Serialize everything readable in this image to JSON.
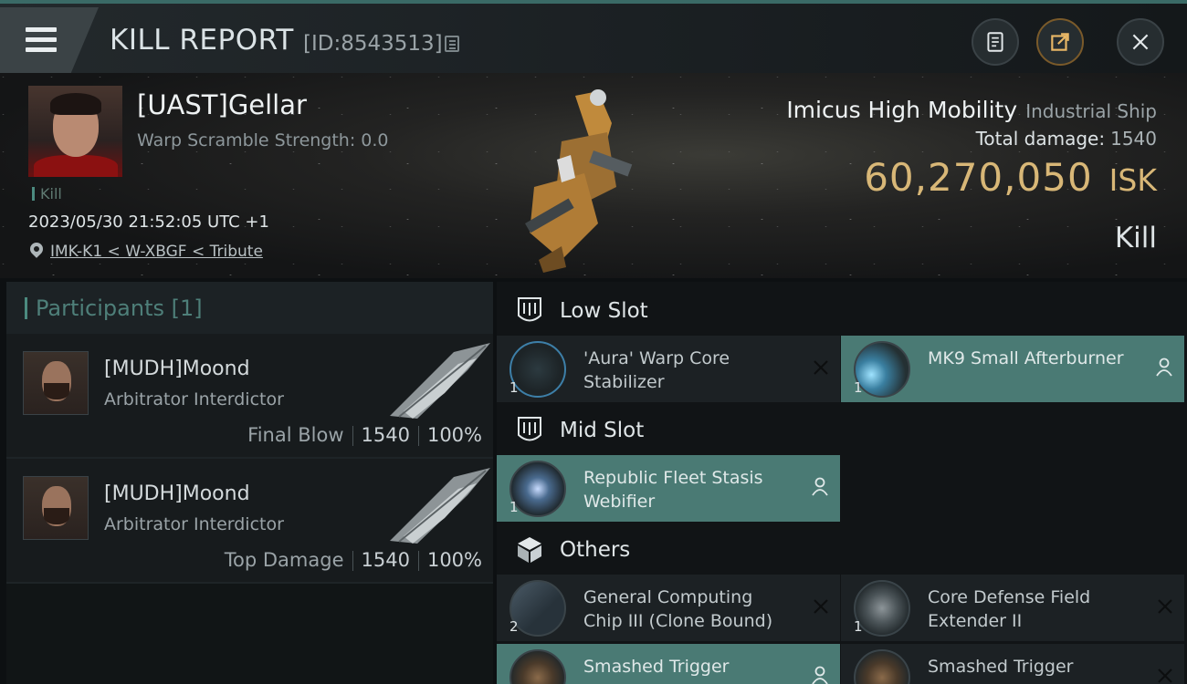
{
  "header": {
    "title": "KILL REPORT",
    "report_id": "[ID:8543513]"
  },
  "victim": {
    "name": "[UAST]Gellar",
    "warp_scramble": "Warp Scramble Strength: 0.0",
    "tag": "Kill",
    "datetime": "2023/05/30 21:52:05 UTC +1",
    "location": "IMK-K1 < W-XBGF < Tribute"
  },
  "ship": {
    "name": "Imicus High Mobility",
    "class": "Industrial Ship",
    "total_damage_label": "Total damage:",
    "total_damage": "1540",
    "value": "60,270,050",
    "currency": "ISK",
    "result": "Kill"
  },
  "participants": {
    "heading": "Participants [1]",
    "rows": [
      {
        "name": "[MUDH]Moond",
        "ship": "Arbitrator Interdictor",
        "role": "Final Blow",
        "damage": "1540",
        "percent": "100%"
      },
      {
        "name": "[MUDH]Moond",
        "ship": "Arbitrator Interdictor",
        "role": "Top Damage",
        "damage": "1540",
        "percent": "100%"
      }
    ]
  },
  "slots": {
    "low": {
      "title": "Low Slot",
      "items": [
        {
          "name": "'Aura' Warp Core Stabilizer",
          "qty": "1",
          "status": "destroyed"
        },
        {
          "name": "MK9 Small Afterburner",
          "qty": "1",
          "status": "dropped"
        }
      ]
    },
    "mid": {
      "title": "Mid Slot",
      "items": [
        {
          "name": "Republic Fleet Stasis Webifier",
          "qty": "1",
          "status": "dropped"
        }
      ]
    },
    "others": {
      "title": "Others",
      "items": [
        {
          "name": "General Computing Chip III (Clone Bound)",
          "qty": "2",
          "status": "destroyed"
        },
        {
          "name": "Core Defense Field Extender II",
          "qty": "1",
          "status": "destroyed"
        },
        {
          "name": "Smashed Trigger",
          "qty": "",
          "status": "dropped"
        },
        {
          "name": "Smashed Trigger",
          "qty": "",
          "status": "destroyed"
        }
      ]
    }
  },
  "colors": {
    "accent": "#4c8b80",
    "isk_gold": "#d8b777",
    "dropped_bg": "#4a7a74",
    "destroyed_bg": "#1c2124"
  },
  "icons": [
    "menu-icon",
    "copy-icon",
    "clipboard-icon",
    "share-icon",
    "close-icon",
    "location-pin-icon",
    "low-slot-icon",
    "mid-slot-icon",
    "others-cube-icon",
    "destroyed-x-icon",
    "dropped-person-icon"
  ]
}
